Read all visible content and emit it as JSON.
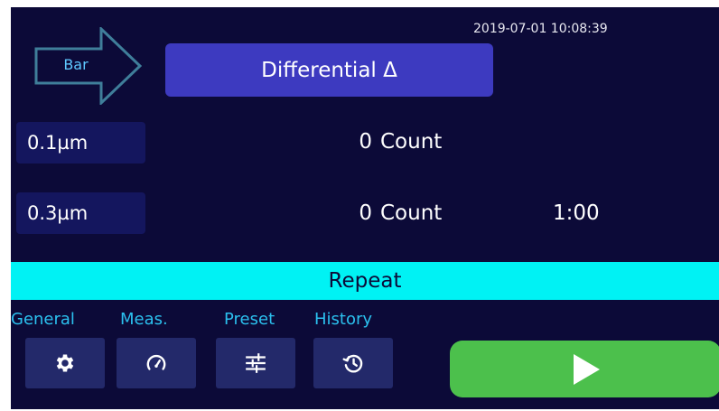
{
  "header": {
    "timestamp": "2019-07-01 10:08:39",
    "view_label": "Bar",
    "mode_label": "Differential Δ"
  },
  "channels": [
    {
      "size": "0.1µm",
      "count": "0",
      "unit": "Count"
    },
    {
      "size": "0.3µm",
      "count": "0",
      "unit": "Count"
    }
  ],
  "timer": "1:00",
  "repeat_label": "Repeat",
  "tabs": [
    {
      "label": "General",
      "icon": "gear-icon"
    },
    {
      "label": "Meas.",
      "icon": "gauge-icon"
    },
    {
      "label": "Preset",
      "icon": "sliders-icon"
    },
    {
      "label": "History",
      "icon": "history-icon"
    }
  ],
  "start_icon": "play-icon",
  "colors": {
    "background": "#0c0a38",
    "mode_button": "#3d3ac0",
    "repeat_bar": "#00f2f4",
    "tab_label": "#2bc0ee",
    "start_button": "#4cc04c"
  }
}
